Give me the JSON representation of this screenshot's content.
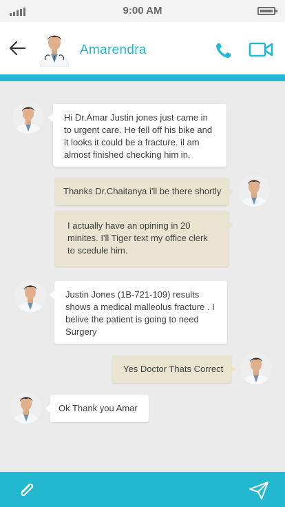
{
  "status_bar": {
    "time": "9:00 AM",
    "signal_icon": "signal-bars-icon",
    "battery_icon": "battery-icon"
  },
  "header": {
    "contact_name": "Amarendra",
    "back_icon": "arrow-left-icon",
    "call_icon": "phone-icon",
    "video_icon": "video-camera-icon"
  },
  "colors": {
    "accent": "#22b8cf",
    "incoming_bubble": "#ffffff",
    "outgoing_bubble": "#e8e4d0",
    "background": "#ebebeb"
  },
  "messages": [
    {
      "direction": "incoming",
      "lines": [
        "Hi Dr.Amar Justin jones just came in",
        "to urgent care. He fell off his bike and",
        "it looks it could be a fracture. il am",
        "almost finished checking him in."
      ]
    },
    {
      "direction": "outgoing",
      "lines": [
        "Thanks Dr.Chaitanya i'll be there shortly"
      ]
    },
    {
      "direction": "outgoing",
      "lines": [
        "I actually have an opining in 20",
        "minites. I'll Tiger text my office clerk",
        "to scedule him."
      ]
    },
    {
      "direction": "incoming",
      "lines": [
        "Justin Jones (1B-721-109) results",
        "shows a medical malleolus fracture . I",
        "belive the patient is going to need",
        "Surgery"
      ]
    },
    {
      "direction": "outgoing",
      "lines": [
        "Yes Doctor Thats Correct"
      ]
    },
    {
      "direction": "incoming",
      "lines": [
        "Ok Thank you Amar"
      ]
    }
  ],
  "footer": {
    "attach_icon": "paperclip-icon",
    "send_icon": "send-icon"
  }
}
